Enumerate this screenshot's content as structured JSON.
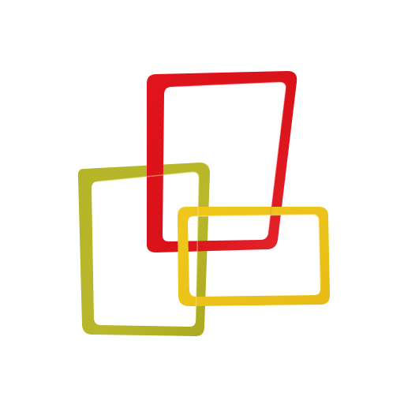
{
  "logo": {
    "shapes": [
      {
        "name": "red-frame",
        "color": "#e0141c",
        "highlight": "#ff5a5a"
      },
      {
        "name": "olive-frame",
        "color": "#b7b62a",
        "highlight": "#e2e06a"
      },
      {
        "name": "yellow-frame",
        "color": "#ecc21a",
        "highlight": "#ffe36a"
      }
    ]
  }
}
